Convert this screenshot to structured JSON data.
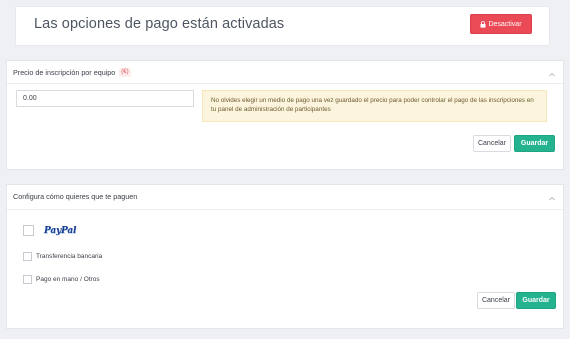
{
  "banner": {
    "title": "Las opciones de pago están activadas",
    "deactivate_label": "Desactivar",
    "deactivate_icon": "lock-icon",
    "deactivate_color": "#ea4a56"
  },
  "price_panel": {
    "title": "Precio de inscripción por equipo",
    "currency_badge": "(€)",
    "price_value": "0.00",
    "notice": "No olvides elegir un medio de pago una vez guardado el precio para poder controlar el pago de las inscripciones en tu panel de administración de participantes",
    "cancel_label": "Cancelar",
    "save_label": "Guardar",
    "collapse_icon": "chevron-up-icon"
  },
  "payment_panel": {
    "title": "Configura cómo quieres que te paguen",
    "options": [
      {
        "label": "PayPal",
        "icon": "paypal-logo",
        "checked": false
      },
      {
        "label": "Transferencia bancaria",
        "checked": false
      },
      {
        "label": "Pago en mano / Otros",
        "checked": false
      }
    ],
    "cancel_label": "Cancelar",
    "save_label": "Guardar",
    "collapse_icon": "chevron-up-icon"
  },
  "colors": {
    "accent_green": "#24b28f",
    "danger_red": "#ea4a56",
    "notice_bg": "#fcf4dd"
  }
}
